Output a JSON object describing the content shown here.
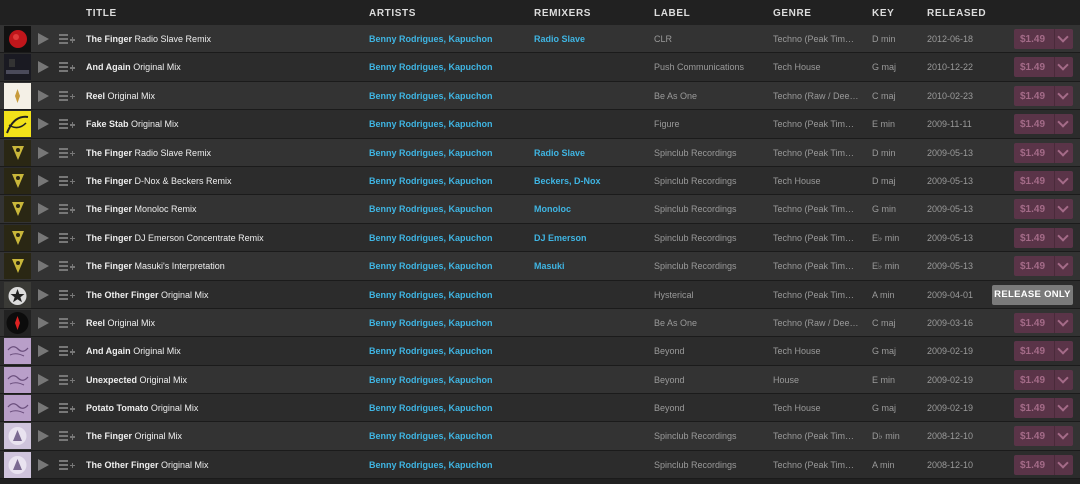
{
  "header": {
    "title": "TITLE",
    "artists": "ARTISTS",
    "remixers": "REMIXERS",
    "label": "LABEL",
    "genre": "GENRE",
    "key": "KEY",
    "released": "RELEASED"
  },
  "colors": {
    "accent_link": "#3fb5e3",
    "buy_button_bg": "#5a3448",
    "buy_button_text": "#a46b88",
    "release_only_bg": "#7a7a7a"
  },
  "icons": {
    "play": "play-icon",
    "queue": "add-to-queue-icon",
    "dropdown": "chevron-down-icon"
  },
  "tracks": [
    {
      "title": "The Finger",
      "mix": "Radio Slave Remix",
      "artists": "Benny Rodrigues, Kapuchon",
      "remixers": "Radio Slave",
      "label": "CLR",
      "genre": "Techno (Peak Tim…",
      "key": "D min",
      "released": "2012-06-18",
      "price": "$1.49",
      "art": "red"
    },
    {
      "title": "And Again",
      "mix": "Original Mix",
      "artists": "Benny Rodrigues, Kapuchon",
      "remixers": "",
      "label": "Push Communications",
      "genre": "Tech House",
      "key": "G maj",
      "released": "2010-12-22",
      "price": "$1.49",
      "art": "dark"
    },
    {
      "title": "Reel",
      "mix": "Original Mix",
      "artists": "Benny Rodrigues, Kapuchon",
      "remixers": "",
      "label": "Be As One",
      "genre": "Techno (Raw / Dee…",
      "key": "C maj",
      "released": "2010-02-23",
      "price": "$1.49",
      "art": "white"
    },
    {
      "title": "Fake Stab",
      "mix": "Original Mix",
      "artists": "Benny Rodrigues, Kapuchon",
      "remixers": "",
      "label": "Figure",
      "genre": "Techno (Peak Tim…",
      "key": "E min",
      "released": "2009-11-11",
      "price": "$1.49",
      "art": "yellow"
    },
    {
      "title": "The Finger",
      "mix": "Radio Slave Remix",
      "artists": "Benny Rodrigues, Kapuchon",
      "remixers": "Radio Slave",
      "label": "Spinclub Recordings",
      "genre": "Techno (Peak Tim…",
      "key": "D min",
      "released": "2009-05-13",
      "price": "$1.49",
      "art": "olive"
    },
    {
      "title": "The Finger",
      "mix": "D-Nox & Beckers Remix",
      "artists": "Benny Rodrigues, Kapuchon",
      "remixers": "Beckers, D-Nox",
      "label": "Spinclub Recordings",
      "genre": "Tech House",
      "key": "D maj",
      "released": "2009-05-13",
      "price": "$1.49",
      "art": "olive"
    },
    {
      "title": "The Finger",
      "mix": "Monoloc Remix",
      "artists": "Benny Rodrigues, Kapuchon",
      "remixers": "Monoloc",
      "label": "Spinclub Recordings",
      "genre": "Techno (Peak Tim…",
      "key": "G min",
      "released": "2009-05-13",
      "price": "$1.49",
      "art": "olive"
    },
    {
      "title": "The Finger",
      "mix": "DJ Emerson Concentrate Remix",
      "artists": "Benny Rodrigues, Kapuchon",
      "remixers": "DJ Emerson",
      "label": "Spinclub Recordings",
      "genre": "Techno (Peak Tim…",
      "key": "E♭ min",
      "released": "2009-05-13",
      "price": "$1.49",
      "art": "olive"
    },
    {
      "title": "The Finger",
      "mix": "Masuki's Interpretation",
      "artists": "Benny Rodrigues, Kapuchon",
      "remixers": "Masuki",
      "label": "Spinclub Recordings",
      "genre": "Techno (Peak Tim…",
      "key": "E♭ min",
      "released": "2009-05-13",
      "price": "$1.49",
      "art": "olive"
    },
    {
      "title": "The Other Finger",
      "mix": "Original Mix",
      "artists": "Benny Rodrigues, Kapuchon",
      "remixers": "",
      "label": "Hysterical",
      "genre": "Techno (Peak Tim…",
      "key": "A min",
      "released": "2009-04-01",
      "price": "",
      "release_only": "RELEASE ONLY",
      "art": "star"
    },
    {
      "title": "Reel",
      "mix": "Original Mix",
      "artists": "Benny Rodrigues, Kapuchon",
      "remixers": "",
      "label": "Be As One",
      "genre": "Techno (Raw / Dee…",
      "key": "C maj",
      "released": "2009-03-16",
      "price": "$1.49",
      "art": "black"
    },
    {
      "title": "And Again",
      "mix": "Original Mix",
      "artists": "Benny Rodrigues, Kapuchon",
      "remixers": "",
      "label": "Beyond",
      "genre": "Tech House",
      "key": "G maj",
      "released": "2009-02-19",
      "price": "$1.49",
      "art": "lilac"
    },
    {
      "title": "Unexpected",
      "mix": "Original Mix",
      "artists": "Benny Rodrigues, Kapuchon",
      "remixers": "",
      "label": "Beyond",
      "genre": "House",
      "key": "E min",
      "released": "2009-02-19",
      "price": "$1.49",
      "art": "lilac"
    },
    {
      "title": "Potato Tomato",
      "mix": "Original Mix",
      "artists": "Benny Rodrigues, Kapuchon",
      "remixers": "",
      "label": "Beyond",
      "genre": "Tech House",
      "key": "G maj",
      "released": "2009-02-19",
      "price": "$1.49",
      "art": "lilac"
    },
    {
      "title": "The Finger",
      "mix": "Original Mix",
      "artists": "Benny Rodrigues, Kapuchon",
      "remixers": "",
      "label": "Spinclub Recordings",
      "genre": "Techno (Peak Tim…",
      "key": "D♭ min",
      "released": "2008-12-10",
      "price": "$1.49",
      "art": "lavender"
    },
    {
      "title": "The Other Finger",
      "mix": "Original Mix",
      "artists": "Benny Rodrigues, Kapuchon",
      "remixers": "",
      "label": "Spinclub Recordings",
      "genre": "Techno (Peak Tim…",
      "key": "A min",
      "released": "2008-12-10",
      "price": "$1.49",
      "art": "lavender"
    }
  ]
}
